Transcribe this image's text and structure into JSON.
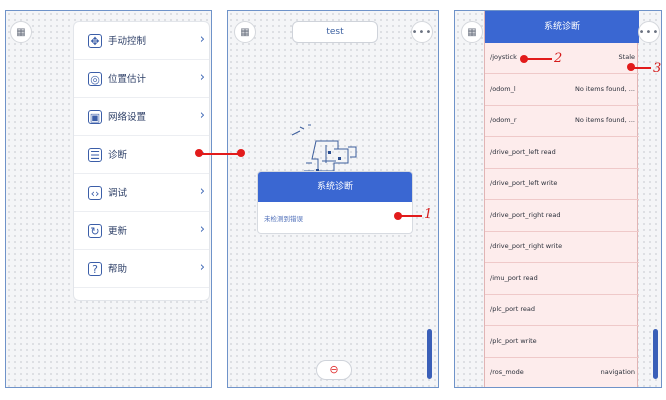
{
  "panel1": {
    "menu": [
      {
        "icon": "move-icon",
        "glyph": "✥",
        "label": "手动控制"
      },
      {
        "icon": "location-icon",
        "glyph": "◎",
        "label": "位置估计"
      },
      {
        "icon": "network-icon",
        "glyph": "▣",
        "label": "网络设置"
      },
      {
        "icon": "diagnose-icon",
        "glyph": "☰",
        "label": "诊断"
      },
      {
        "icon": "debug-icon",
        "glyph": "‹›",
        "label": "调试"
      },
      {
        "icon": "update-icon",
        "glyph": "↻",
        "label": "更新"
      },
      {
        "icon": "help-icon",
        "glyph": "?",
        "label": "帮助"
      }
    ]
  },
  "panel2": {
    "title": "test",
    "dialog": {
      "header": "系统诊断",
      "message": "未检测到错误"
    }
  },
  "panel3": {
    "header": "系统诊断",
    "rows": [
      {
        "key": "/joystick",
        "value": "Stale"
      },
      {
        "key": "/odom_l",
        "value": "No items found, ..."
      },
      {
        "key": "/odom_r",
        "value": "No items found, ..."
      },
      {
        "key": "/drive_port_left read",
        "value": ""
      },
      {
        "key": "/drive_port_left write",
        "value": ""
      },
      {
        "key": "/drive_port_right read",
        "value": ""
      },
      {
        "key": "/drive_port_right write",
        "value": ""
      },
      {
        "key": "/imu_port read",
        "value": ""
      },
      {
        "key": "/plc_port read",
        "value": ""
      },
      {
        "key": "/plc_port write",
        "value": ""
      },
      {
        "key": "/ros_mode",
        "value": "navigation"
      }
    ]
  },
  "callouts": {
    "one": "1",
    "two": "2",
    "three": "3"
  },
  "colors": {
    "accent": "#3a67d2",
    "callout": "#e21b1b",
    "error_bg": "#fdecec"
  }
}
